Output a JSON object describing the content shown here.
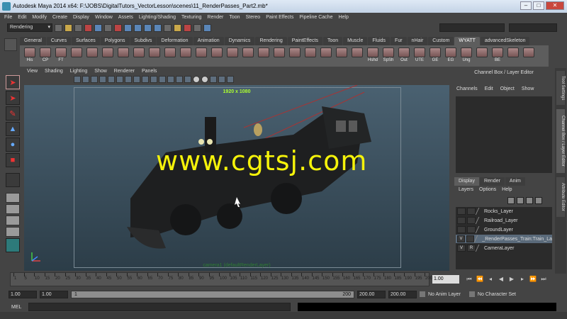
{
  "window": {
    "title": "Autodesk Maya 2014 x64: F:\\JOBS\\DigitalTutors_VectorLesson\\scenes\\11_RenderPasses_Part2.mb*"
  },
  "menus": [
    "File",
    "Edit",
    "Modify",
    "Create",
    "Display",
    "Window",
    "Assets",
    "Lighting/Shading",
    "Texturing",
    "Render",
    "Toon",
    "Stereo",
    "Paint Effects",
    "Pipeline Cache",
    "Help"
  ],
  "status_line": {
    "menu_set": "Rendering"
  },
  "shelf_tabs": [
    "General",
    "Curves",
    "Surfaces",
    "Polygons",
    "Subdivs",
    "Deformation",
    "Animation",
    "Dynamics",
    "Rendering",
    "PaintEffects",
    "Toon",
    "Muscle",
    "Fluids",
    "Fur",
    "nHair",
    "Custom",
    "WYATT",
    "advancedSkeleton"
  ],
  "shelf_active_tab": "WYATT",
  "shelf_buttons": [
    "His",
    "CP",
    "FT",
    "",
    "",
    "",
    "",
    "",
    "",
    "",
    "",
    "",
    "",
    "",
    "",
    "",
    "",
    "",
    "",
    "",
    "",
    "",
    "Hshd",
    "SpSh",
    "Out",
    "UTE",
    "GE",
    "EG",
    "Ung",
    "",
    "BE",
    "",
    ""
  ],
  "panel_menu": [
    "View",
    "Shading",
    "Lighting",
    "Show",
    "Renderer",
    "Panels"
  ],
  "viewport": {
    "resolution": "1920 x 1080",
    "camera_label": "camera1 (defaultRenderLayer)"
  },
  "watermark": "www.cgtsj.com",
  "channel_box": {
    "header": "Channel Box / Layer Editor",
    "menu": [
      "Channels",
      "Edit",
      "Object",
      "Show"
    ]
  },
  "layer_editor": {
    "tabs": [
      "Display",
      "Render",
      "Anim"
    ],
    "active_tab": "Display",
    "menu": [
      "Layers",
      "Options",
      "Help"
    ],
    "layers": [
      {
        "v": "",
        "r": "",
        "name": "Rocks_Layer",
        "selected": false
      },
      {
        "v": "",
        "r": "",
        "name": "Railroad_Layer",
        "selected": false
      },
      {
        "v": "",
        "r": "",
        "name": "GroundLayer",
        "selected": false
      },
      {
        "v": "V",
        "r": "",
        "name": "_RenderPasses_Train:Train_La",
        "selected": true
      },
      {
        "v": "V",
        "r": "R",
        "name": "CameraLayer",
        "selected": false
      }
    ]
  },
  "side_tabs": [
    "Tool Settings",
    "Channel Box / Layer Editor",
    "Attribute Editor"
  ],
  "timeline": {
    "ticks": [
      "1",
      "5",
      "10",
      "15",
      "20",
      "25",
      "30",
      "35",
      "40",
      "45",
      "50",
      "55",
      "60",
      "65",
      "70",
      "75",
      "80",
      "85",
      "90",
      "95",
      "100",
      "105",
      "110",
      "115",
      "120",
      "125",
      "130",
      "135",
      "140",
      "145",
      "150",
      "155",
      "160",
      "165",
      "170",
      "175",
      "180",
      "185",
      "190",
      "195",
      "200"
    ],
    "current_frame": "1.00"
  },
  "range": {
    "start": "1.00",
    "playback_start": "1.00",
    "slider_start": "1",
    "slider_end": "200",
    "playback_end": "200.00",
    "end": "200.00",
    "anim_layer": "No Anim Layer",
    "character_set": "No Character Set"
  },
  "command_line": {
    "label": "MEL"
  }
}
